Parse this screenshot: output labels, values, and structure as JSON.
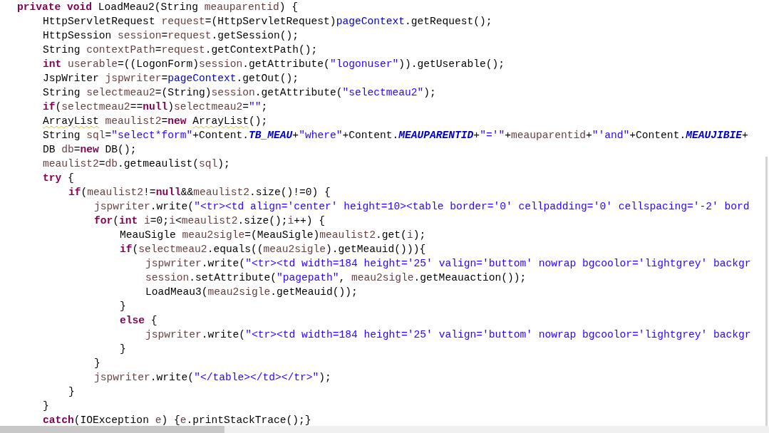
{
  "editor": {
    "lines": [
      {
        "tokens": [
          {
            "kind": "keyword",
            "text": "private void"
          },
          {
            "kind": "plain",
            "text": " LoadMeau2(String "
          },
          {
            "kind": "variable",
            "text": "meauparentid"
          },
          {
            "kind": "plain",
            "text": ") {"
          }
        ]
      },
      {
        "tokens": [
          {
            "kind": "plain",
            "text": "\tHttpServletRequest "
          },
          {
            "kind": "variable",
            "text": "request"
          },
          {
            "kind": "plain",
            "text": "=(HttpServletRequest)"
          },
          {
            "kind": "member",
            "text": "pageContext"
          },
          {
            "kind": "plain",
            "text": ".getRequest();"
          }
        ]
      },
      {
        "tokens": [
          {
            "kind": "plain",
            "text": "\tHttpSession "
          },
          {
            "kind": "variable",
            "text": "session"
          },
          {
            "kind": "plain",
            "text": "="
          },
          {
            "kind": "variable",
            "text": "request"
          },
          {
            "kind": "plain",
            "text": ".getSession();"
          }
        ]
      },
      {
        "tokens": [
          {
            "kind": "plain",
            "text": "\tString "
          },
          {
            "kind": "variable",
            "text": "contextPath"
          },
          {
            "kind": "plain",
            "text": "="
          },
          {
            "kind": "variable",
            "text": "request"
          },
          {
            "kind": "plain",
            "text": ".getContextPath();"
          }
        ]
      },
      {
        "tokens": [
          {
            "kind": "keyword",
            "text": "\tint "
          },
          {
            "kind": "variable",
            "text": "userable"
          },
          {
            "kind": "plain",
            "text": "=((LogonForm)"
          },
          {
            "kind": "variable",
            "text": "session"
          },
          {
            "kind": "plain",
            "text": ".getAttribute("
          },
          {
            "kind": "string",
            "text": "\"logonuser\""
          },
          {
            "kind": "plain",
            "text": ")).getUserable();"
          }
        ]
      },
      {
        "tokens": [
          {
            "kind": "plain",
            "text": "\tJspWriter "
          },
          {
            "kind": "variable",
            "text": "jspwriter"
          },
          {
            "kind": "plain",
            "text": "="
          },
          {
            "kind": "member",
            "text": "pageContext"
          },
          {
            "kind": "plain",
            "text": ".getOut();"
          }
        ]
      },
      {
        "tokens": [
          {
            "kind": "plain",
            "text": "\tString "
          },
          {
            "kind": "variable",
            "text": "selectmeau2"
          },
          {
            "kind": "plain",
            "text": "=(String)"
          },
          {
            "kind": "variable",
            "text": "session"
          },
          {
            "kind": "plain",
            "text": ".getAttribute("
          },
          {
            "kind": "string",
            "text": "\"selectmeau2\""
          },
          {
            "kind": "plain",
            "text": ");"
          }
        ]
      },
      {
        "tokens": [
          {
            "kind": "keyword",
            "text": "\tif"
          },
          {
            "kind": "plain",
            "text": "("
          },
          {
            "kind": "variable",
            "text": "selectmeau2"
          },
          {
            "kind": "plain",
            "text": "=="
          },
          {
            "kind": "keyword",
            "text": "null"
          },
          {
            "kind": "plain",
            "text": ")"
          },
          {
            "kind": "variable",
            "text": "selectmeau2"
          },
          {
            "kind": "plain",
            "text": "="
          },
          {
            "kind": "string",
            "text": "\"\""
          },
          {
            "kind": "plain",
            "text": ";"
          }
        ]
      },
      {
        "tokens": [
          {
            "kind": "warning",
            "text": "\tArrayList"
          },
          {
            "kind": "variable",
            "text": " meaulist2"
          },
          {
            "kind": "plain",
            "text": "="
          },
          {
            "kind": "keyword",
            "text": "new "
          },
          {
            "kind": "warning",
            "text": "ArrayList"
          },
          {
            "kind": "plain",
            "text": "();"
          }
        ]
      },
      {
        "tokens": [
          {
            "kind": "plain",
            "text": "\tString "
          },
          {
            "kind": "variable",
            "text": "sql"
          },
          {
            "kind": "plain",
            "text": "="
          },
          {
            "kind": "string",
            "text": "\"select*form\""
          },
          {
            "kind": "plain",
            "text": "+Content."
          },
          {
            "kind": "constant",
            "text": "TB_MEAU"
          },
          {
            "kind": "plain",
            "text": "+"
          },
          {
            "kind": "string",
            "text": "\"where\""
          },
          {
            "kind": "plain",
            "text": "+Content."
          },
          {
            "kind": "constant",
            "text": "MEAUPARENTID"
          },
          {
            "kind": "plain",
            "text": "+"
          },
          {
            "kind": "string",
            "text": "\"='\""
          },
          {
            "kind": "plain",
            "text": "+"
          },
          {
            "kind": "variable",
            "text": "meauparentid"
          },
          {
            "kind": "plain",
            "text": "+"
          },
          {
            "kind": "string",
            "text": "\"'and\""
          },
          {
            "kind": "plain",
            "text": "+Content."
          },
          {
            "kind": "constant",
            "text": "MEAUJIBIE"
          },
          {
            "kind": "plain",
            "text": "+"
          }
        ]
      },
      {
        "tokens": [
          {
            "kind": "plain",
            "text": "\tDB "
          },
          {
            "kind": "variable",
            "text": "db"
          },
          {
            "kind": "plain",
            "text": "="
          },
          {
            "kind": "keyword",
            "text": "new"
          },
          {
            "kind": "plain",
            "text": " DB();"
          }
        ]
      },
      {
        "tokens": [
          {
            "kind": "variable",
            "text": "\tmeaulist2"
          },
          {
            "kind": "plain",
            "text": "="
          },
          {
            "kind": "variable",
            "text": "db"
          },
          {
            "kind": "plain",
            "text": ".getmeaulist("
          },
          {
            "kind": "variable",
            "text": "sql"
          },
          {
            "kind": "plain",
            "text": ");"
          }
        ]
      },
      {
        "tokens": [
          {
            "kind": "keyword",
            "text": "\ttry"
          },
          {
            "kind": "plain",
            "text": " {"
          }
        ]
      },
      {
        "tokens": [
          {
            "kind": "keyword",
            "text": "\t\tif"
          },
          {
            "kind": "plain",
            "text": "("
          },
          {
            "kind": "variable",
            "text": "meaulist2"
          },
          {
            "kind": "plain",
            "text": "!="
          },
          {
            "kind": "keyword",
            "text": "null"
          },
          {
            "kind": "plain",
            "text": "&&"
          },
          {
            "kind": "variable",
            "text": "meaulist2"
          },
          {
            "kind": "plain",
            "text": ".size()!=0) {"
          }
        ]
      },
      {
        "tokens": [
          {
            "kind": "variable",
            "text": "\t\t\tjspwriter"
          },
          {
            "kind": "plain",
            "text": ".write("
          },
          {
            "kind": "string",
            "text": "\"<tr><td align='center' height=10><table border='0' cellpadding='0' cellspacing='-2' bord"
          }
        ]
      },
      {
        "tokens": [
          {
            "kind": "keyword",
            "text": "\t\t\tfor"
          },
          {
            "kind": "plain",
            "text": "("
          },
          {
            "kind": "keyword",
            "text": "int "
          },
          {
            "kind": "variable",
            "text": "i"
          },
          {
            "kind": "plain",
            "text": "=0;"
          },
          {
            "kind": "variable",
            "text": "i"
          },
          {
            "kind": "plain",
            "text": "<"
          },
          {
            "kind": "variable",
            "text": "meaulist2"
          },
          {
            "kind": "plain",
            "text": ".size();"
          },
          {
            "kind": "variable",
            "text": "i"
          },
          {
            "kind": "plain",
            "text": "++) {"
          }
        ]
      },
      {
        "tokens": [
          {
            "kind": "plain",
            "text": "\t\t\t\tMeauSigle "
          },
          {
            "kind": "variable",
            "text": "meau2sigle"
          },
          {
            "kind": "plain",
            "text": "=(MeauSigle)"
          },
          {
            "kind": "variable",
            "text": "meaulist2"
          },
          {
            "kind": "plain",
            "text": ".get("
          },
          {
            "kind": "variable",
            "text": "i"
          },
          {
            "kind": "plain",
            "text": ");"
          }
        ]
      },
      {
        "tokens": [
          {
            "kind": "keyword",
            "text": "\t\t\t\tif"
          },
          {
            "kind": "plain",
            "text": "("
          },
          {
            "kind": "variable",
            "text": "selectmeau2"
          },
          {
            "kind": "plain",
            "text": ".equals(("
          },
          {
            "kind": "variable",
            "text": "meau2sigle"
          },
          {
            "kind": "plain",
            "text": ").getMeauid())){"
          }
        ]
      },
      {
        "tokens": [
          {
            "kind": "variable",
            "text": "\t\t\t\t\tjspwriter"
          },
          {
            "kind": "plain",
            "text": ".write("
          },
          {
            "kind": "string",
            "text": "\"<tr><td width=184 height='25' valign='buttom' nowrap bgcoolor='lightgrey' backgr"
          }
        ]
      },
      {
        "tokens": [
          {
            "kind": "variable",
            "text": "\t\t\t\t\tsession"
          },
          {
            "kind": "plain",
            "text": ".setAttribute("
          },
          {
            "kind": "string",
            "text": "\"pagepath\""
          },
          {
            "kind": "plain",
            "text": ", "
          },
          {
            "kind": "variable",
            "text": "meau2sigle"
          },
          {
            "kind": "plain",
            "text": ".getMeauaction());"
          }
        ]
      },
      {
        "tokens": [
          {
            "kind": "plain",
            "text": "\t\t\t\t\tLoadMeau3("
          },
          {
            "kind": "variable",
            "text": "meau2sigle"
          },
          {
            "kind": "plain",
            "text": ".getMeauid());"
          }
        ]
      },
      {
        "tokens": [
          {
            "kind": "plain",
            "text": "\t\t\t\t}"
          }
        ]
      },
      {
        "tokens": [
          {
            "kind": "keyword",
            "text": "\t\t\t\telse"
          },
          {
            "kind": "plain",
            "text": " {"
          }
        ]
      },
      {
        "tokens": [
          {
            "kind": "variable",
            "text": "\t\t\t\t\tjspwriter"
          },
          {
            "kind": "plain",
            "text": ".write("
          },
          {
            "kind": "string",
            "text": "\"<tr><td width=184 height='25' valign='buttom' nowrap bgcoolor='lightgrey' backgr"
          }
        ]
      },
      {
        "tokens": [
          {
            "kind": "plain",
            "text": "\t\t\t\t}"
          }
        ]
      },
      {
        "tokens": [
          {
            "kind": "plain",
            "text": "\t\t\t}"
          }
        ]
      },
      {
        "tokens": [
          {
            "kind": "variable",
            "text": "\t\t\tjspwriter"
          },
          {
            "kind": "plain",
            "text": ".write("
          },
          {
            "kind": "string",
            "text": "\"</table></td></tr>\""
          },
          {
            "kind": "plain",
            "text": ");"
          }
        ]
      },
      {
        "tokens": [
          {
            "kind": "plain",
            "text": "\t\t}"
          }
        ]
      },
      {
        "tokens": [
          {
            "kind": "plain",
            "text": "\t}"
          }
        ]
      },
      {
        "tokens": [
          {
            "kind": "keyword",
            "text": "\tcatch"
          },
          {
            "kind": "plain",
            "text": "(IOException "
          },
          {
            "kind": "variable",
            "text": "e"
          },
          {
            "kind": "plain",
            "text": ") {"
          },
          {
            "kind": "variable",
            "text": "e"
          },
          {
            "kind": "plain",
            "text": ".printStackTrace();}"
          }
        ]
      }
    ]
  }
}
